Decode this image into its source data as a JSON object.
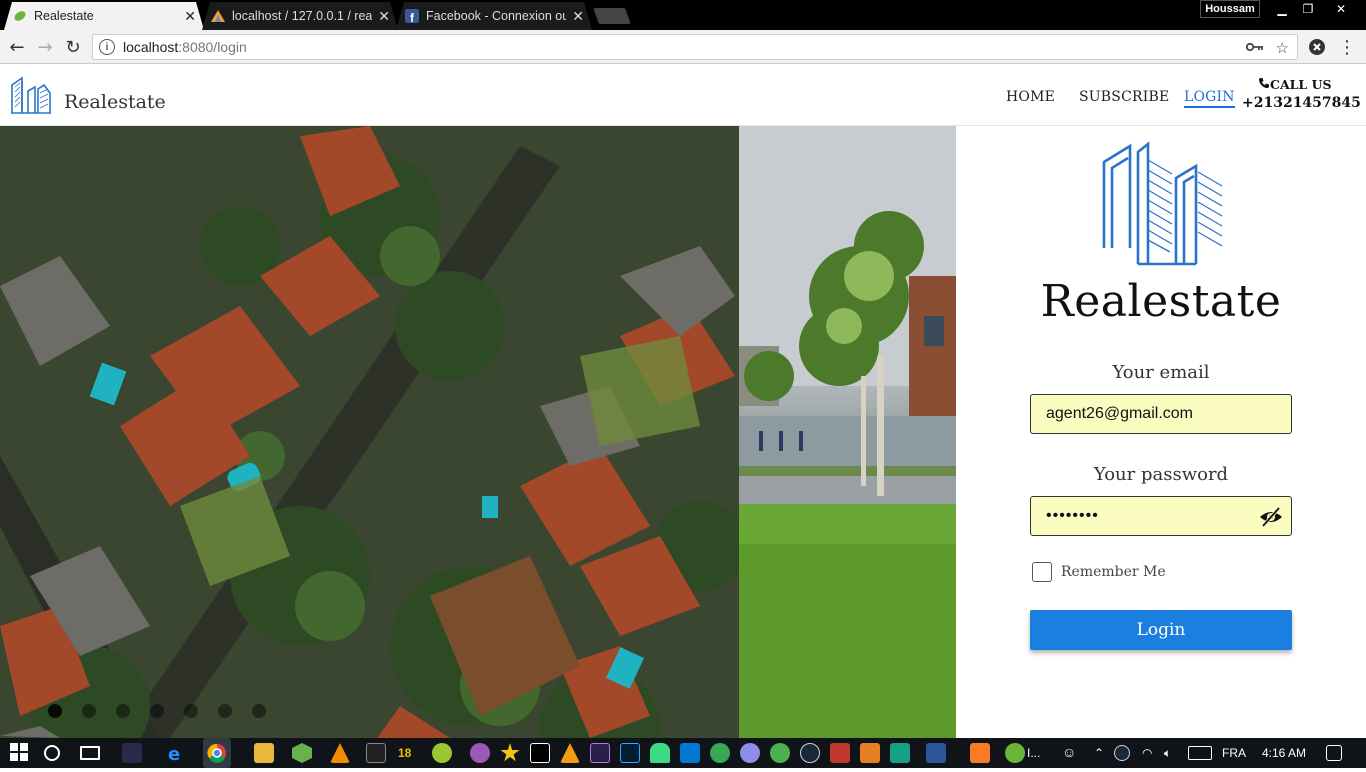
{
  "browser": {
    "tabs": [
      {
        "title": "Realestate",
        "active": true
      },
      {
        "title": "localhost / 127.0.0.1 / rea",
        "active": false
      },
      {
        "title": "Facebook - Connexion ou",
        "active": false
      }
    ],
    "user_name": "Houssam",
    "url_host": "localhost",
    "url_path": ":8080/login"
  },
  "header": {
    "brand_name": "Realestate",
    "nav": [
      {
        "label": "HOME",
        "active": false
      },
      {
        "label": "SUBSCRIBE",
        "active": false
      },
      {
        "label": "LOGIN",
        "active": true
      }
    ],
    "call_label": "CALL US",
    "phone": "+21321457845"
  },
  "login": {
    "title": "Realestate",
    "email_label": "Your email",
    "email_value": "agent26@gmail.com",
    "password_label": "Your password",
    "password_value": "••••••••",
    "remember_label": "Remember Me",
    "remember_checked": false,
    "submit_label": "Login"
  },
  "taskbar": {
    "language": "FRA",
    "time": "4:16 AM",
    "badge_count": "18",
    "active_window": "I..."
  },
  "colors": {
    "accent": "#1b7fe0",
    "input_bg": "#fbfcc0"
  }
}
